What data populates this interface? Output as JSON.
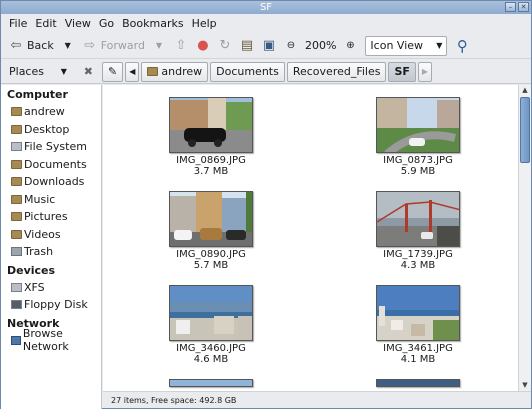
{
  "window": {
    "title": "SF"
  },
  "menubar": [
    "File",
    "Edit",
    "View",
    "Go",
    "Bookmarks",
    "Help"
  ],
  "toolbar": {
    "back": "Back",
    "forward": "Forward",
    "zoom": "200%",
    "view_mode": "Icon View"
  },
  "pathbar": {
    "places_label": "Places",
    "crumbs": [
      "andrew",
      "Documents",
      "Recovered_Files",
      "SF"
    ]
  },
  "sidebar": {
    "computer_label": "Computer",
    "computer_items": [
      "andrew",
      "Desktop",
      "File System",
      "Documents",
      "Downloads",
      "Music",
      "Pictures",
      "Videos",
      "Trash"
    ],
    "devices_label": "Devices",
    "device_items": [
      "XFS",
      "Floppy Disk"
    ],
    "network_label": "Network",
    "network_items": [
      "Browse Network"
    ]
  },
  "files": [
    {
      "name": "IMG_0869.JPG",
      "size": "3.7 MB"
    },
    {
      "name": "IMG_0873.JPG",
      "size": "5.9 MB"
    },
    {
      "name": "IMG_0890.JPG",
      "size": "5.7 MB"
    },
    {
      "name": "IMG_1739.JPG",
      "size": "4.3 MB"
    },
    {
      "name": "IMG_3460.JPG",
      "size": "4.6 MB"
    },
    {
      "name": "IMG_3461.JPG",
      "size": "4.1 MB"
    }
  ],
  "status": "27 items, Free space: 492.8 GB"
}
